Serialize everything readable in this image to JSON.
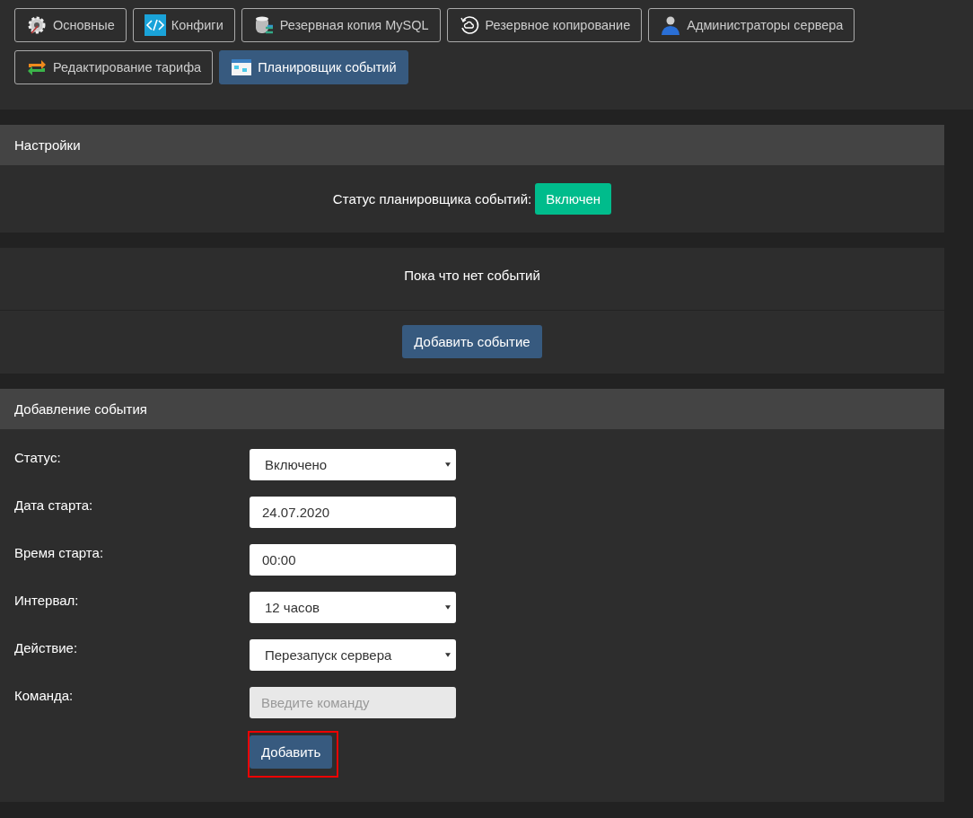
{
  "tabs": [
    {
      "label": "Основные",
      "kind": "gear",
      "selected": false
    },
    {
      "label": "Конфиги",
      "kind": "code",
      "selected": false
    },
    {
      "label": "Резервная копия MySQL",
      "kind": "database",
      "selected": false
    },
    {
      "label": "Резервное копирование",
      "kind": "cloud",
      "selected": false
    },
    {
      "label": "Администраторы сервера",
      "kind": "user",
      "selected": false
    },
    {
      "label": "Редактирование тарифа",
      "kind": "arrows",
      "selected": false
    },
    {
      "label": "Планировщик событий",
      "kind": "calendar",
      "selected": true
    }
  ],
  "settings": {
    "title": "Настройки",
    "status_label": "Статус планировщика событий:",
    "status_value": "Включен",
    "on": true
  },
  "events": {
    "empty_text": "Пока что нет событий",
    "add_button": "Добавить событие"
  },
  "form": {
    "title": "Добавление события",
    "fields": [
      {
        "label": "Статус:",
        "kind": "select",
        "value": "Включено",
        "disabled": false
      },
      {
        "label": "Дата старта:",
        "kind": "input",
        "value": "24.07.2020",
        "disabled": false
      },
      {
        "label": "Время старта:",
        "kind": "input",
        "value": "00:00",
        "disabled": false
      },
      {
        "label": "Интервал:",
        "kind": "select",
        "value": "12 часов",
        "disabled": false
      },
      {
        "label": "Действие:",
        "kind": "select",
        "value": "Перезапуск сервера",
        "disabled": false
      },
      {
        "label": "Команда:",
        "kind": "input",
        "placeholder": "Введите команду",
        "disabled": true
      }
    ],
    "submit": {
      "label": "Добавить",
      "highlighted": true
    }
  }
}
